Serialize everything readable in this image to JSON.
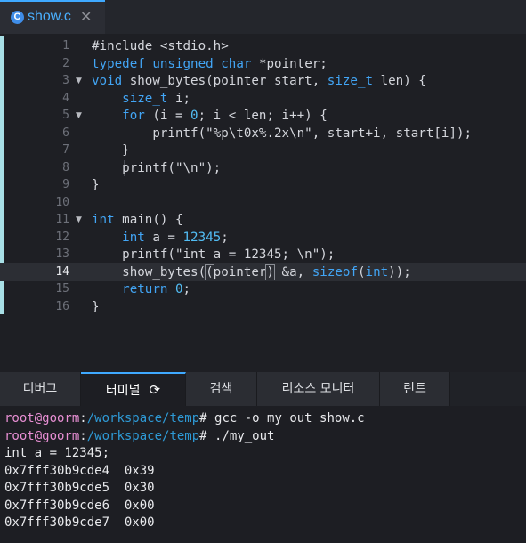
{
  "editor_tab": {
    "filename": "show.c",
    "icon": "C",
    "close": "✕"
  },
  "code_lines": [
    {
      "n": "1",
      "fold": "",
      "tokens": [
        [
          "#include <stdio.h>",
          "plain"
        ]
      ]
    },
    {
      "n": "2",
      "fold": "",
      "tokens": [
        [
          "typedef",
          "kw"
        ],
        [
          " ",
          "plain"
        ],
        [
          "unsigned",
          "kw"
        ],
        [
          " ",
          "plain"
        ],
        [
          "char",
          "kw"
        ],
        [
          " *pointer;",
          "plain"
        ]
      ]
    },
    {
      "n": "3",
      "fold": "▼",
      "tokens": [
        [
          "void",
          "kw"
        ],
        [
          " show_bytes(pointer start, ",
          "plain"
        ],
        [
          "size_t",
          "kw"
        ],
        [
          " len) {",
          "plain"
        ]
      ]
    },
    {
      "n": "4",
      "fold": "",
      "tokens": [
        [
          "    ",
          "plain"
        ],
        [
          "size_t",
          "kw"
        ],
        [
          " i;",
          "plain"
        ]
      ]
    },
    {
      "n": "5",
      "fold": "▼",
      "tokens": [
        [
          "    ",
          "plain"
        ],
        [
          "for",
          "kw"
        ],
        [
          " (i = ",
          "plain"
        ],
        [
          "0",
          "num"
        ],
        [
          "; i < len; i++) {",
          "plain"
        ]
      ]
    },
    {
      "n": "6",
      "fold": "",
      "tokens": [
        [
          "        printf(\"%p\\t0x%.2x\\n\", start+i, start[i]);",
          "plain"
        ]
      ]
    },
    {
      "n": "7",
      "fold": "",
      "tokens": [
        [
          "    }",
          "plain"
        ]
      ]
    },
    {
      "n": "8",
      "fold": "",
      "tokens": [
        [
          "    printf(\"\\n\");",
          "plain"
        ]
      ]
    },
    {
      "n": "9",
      "fold": "",
      "tokens": [
        [
          "}",
          "plain"
        ]
      ]
    },
    {
      "n": "10",
      "fold": "",
      "tokens": []
    },
    {
      "n": "11",
      "fold": "▼",
      "tokens": [
        [
          "int",
          "kw"
        ],
        [
          " main() {",
          "plain"
        ]
      ]
    },
    {
      "n": "12",
      "fold": "",
      "tokens": [
        [
          "    ",
          "plain"
        ],
        [
          "int",
          "kw"
        ],
        [
          " a = ",
          "plain"
        ],
        [
          "12345",
          "num"
        ],
        [
          ";",
          "plain"
        ]
      ]
    },
    {
      "n": "13",
      "fold": "",
      "tokens": [
        [
          "    printf(\"int a = 12345; \\n\");",
          "plain"
        ]
      ]
    },
    {
      "n": "14",
      "fold": "",
      "current": true,
      "tokens": [
        [
          "    show_bytes(",
          "plain"
        ],
        [
          "(",
          "match"
        ],
        [
          "pointer",
          "plain"
        ],
        [
          ")",
          "match"
        ],
        [
          " &a, ",
          "plain"
        ],
        [
          "sizeof",
          "kw"
        ],
        [
          "(",
          "plain"
        ],
        [
          "int",
          "kw"
        ],
        [
          "));",
          "plain"
        ]
      ]
    },
    {
      "n": "15",
      "fold": "",
      "tokens": [
        [
          "    ",
          "plain"
        ],
        [
          "return",
          "kw"
        ],
        [
          " ",
          "plain"
        ],
        [
          "0",
          "num"
        ],
        [
          ";",
          "plain"
        ]
      ]
    },
    {
      "n": "16",
      "fold": "",
      "tokens": [
        [
          "}",
          "plain"
        ]
      ]
    }
  ],
  "panel_tabs": [
    {
      "label": "디버그",
      "active": false
    },
    {
      "label": "터미널",
      "active": true,
      "icon": "⟳"
    },
    {
      "label": "검색",
      "active": false
    },
    {
      "label": "리소스 모니터",
      "active": false
    },
    {
      "label": "린트",
      "active": false
    }
  ],
  "terminal": {
    "prompt_user": "root@goorm",
    "prompt_sep": ":",
    "prompt_path": "/workspace/temp",
    "prompt_end": "# ",
    "commands": [
      "gcc -o my_out show.c",
      "./my_out"
    ],
    "output": [
      "int a = 12345;",
      "0x7fff30b9cde4  0x39",
      "0x7fff30b9cde5  0x30",
      "0x7fff30b9cde6  0x00",
      "0x7fff30b9cde7  0x00"
    ]
  },
  "colors": {
    "accent": "#3fa9ff",
    "keyword": "#42a5f5",
    "terminal_user": "#e88fd4",
    "terminal_path": "#2e9ad6"
  }
}
